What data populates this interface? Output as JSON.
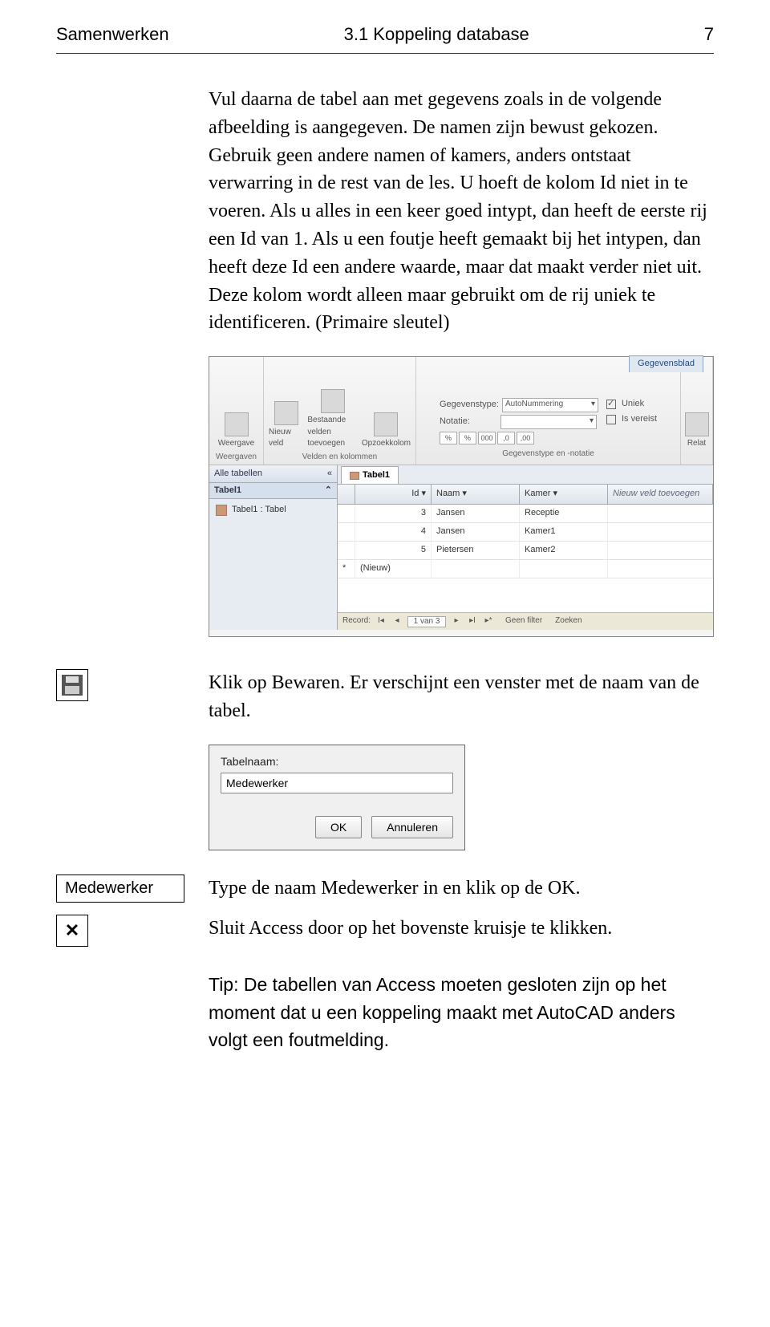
{
  "header": {
    "left": "Samenwerken",
    "center": "3.1 Koppeling database",
    "page": "7"
  },
  "para1": "Vul daarna de tabel aan met gegevens zoals in de volgende afbeelding is aangegeven. De namen zijn bewust gekozen. Gebruik geen andere namen of kamers, anders ontstaat verwarring in de rest van de les. U hoeft de kolom Id niet in te voeren. Als u alles in een keer goed intypt, dan heeft de eerste rij een Id van 1. Als u een foutje heeft gemaakt bij het intypen, dan heeft deze Id een andere waarde, maar dat maakt verder niet uit. Deze kolom wordt alleen maar gebruikt om de rij uniek te identificeren. (Primaire sleutel)",
  "ribbon": {
    "tab": "Gegevensblad",
    "group1": {
      "btn": "Weergave",
      "label": "Weergaven"
    },
    "group2": {
      "b1": "Nieuw veld",
      "b2": "Bestaande velden toevoegen",
      "b3": "Opzoekkolom",
      "label": "Velden en kolommen"
    },
    "group3": {
      "r1lbl": "Gegevenstype:",
      "r1val": "AutoNummering",
      "r2lbl": "Notatie:",
      "fmt": [
        "%",
        "%",
        "000",
        ",0",
        ",00"
      ],
      "chk1": "Uniek",
      "chk2": "Is vereist",
      "label": "Gegevenstype en -notatie"
    },
    "group4": "Relat"
  },
  "nav": {
    "all": "Alle tabellen",
    "section": "Tabel1",
    "item": "Tabel1 : Tabel"
  },
  "table": {
    "tab": "Tabel1",
    "cols": {
      "id": "Id",
      "naam": "Naam",
      "kamer": "Kamer",
      "new": "Nieuw veld toevoegen"
    },
    "rows": [
      {
        "id": "3",
        "naam": "Jansen",
        "kamer": "Receptie"
      },
      {
        "id": "4",
        "naam": "Jansen",
        "kamer": "Kamer1"
      },
      {
        "id": "5",
        "naam": "Pietersen",
        "kamer": "Kamer2"
      }
    ],
    "newrow": "(Nieuw)",
    "recnav": {
      "lbl": "Record:",
      "pos": "1 van 3",
      "filter": "Geen filter",
      "search": "Zoeken"
    }
  },
  "para2": "Klik op Bewaren. Er verschijnt een venster met de naam van de tabel.",
  "dialog": {
    "label": "Tabelnaam:",
    "value": "Medewerker",
    "ok": "OK",
    "cancel": "Annuleren"
  },
  "margin_label": "Medewerker",
  "para3": "Type de naam Medewerker in en klik op de OK.",
  "para4": "Sluit Access door op het bovenste kruisje te klikken.",
  "tip": "Tip: De tabellen van Access moeten gesloten zijn op het moment dat u een koppeling maakt met AutoCAD anders volgt een foutmelding."
}
